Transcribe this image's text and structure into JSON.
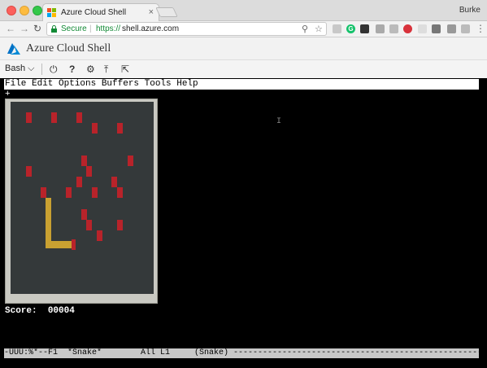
{
  "browser": {
    "tab_title": "Azure Cloud Shell",
    "tab_close": "×",
    "user_name": "Burke",
    "secure_label": "Secure",
    "url_scheme": "https://",
    "url_host": "shell.azure.com"
  },
  "portal": {
    "title": "Azure Cloud Shell",
    "colors": {
      "azure_blue": "#0072c6"
    }
  },
  "shell_toolbar": {
    "shell_type": "Bash",
    "icons": [
      "power-icon",
      "help-icon",
      "settings-icon",
      "upload-icon",
      "open-editor-icon"
    ]
  },
  "terminal": {
    "menu_bar": "File Edit Options Buffers Tools Help",
    "marker": "+",
    "score_label": "Score:",
    "score_value": "00004",
    "mode_line": "-UUU:%*--F1  *Snake*        All L1     (Snake) ----------------------------------------------------------------"
  },
  "game": {
    "colors": {
      "board": "#34393a",
      "food": "#b8232a",
      "snake": "#c9a131",
      "frame": "#c9c9c2"
    }
  }
}
